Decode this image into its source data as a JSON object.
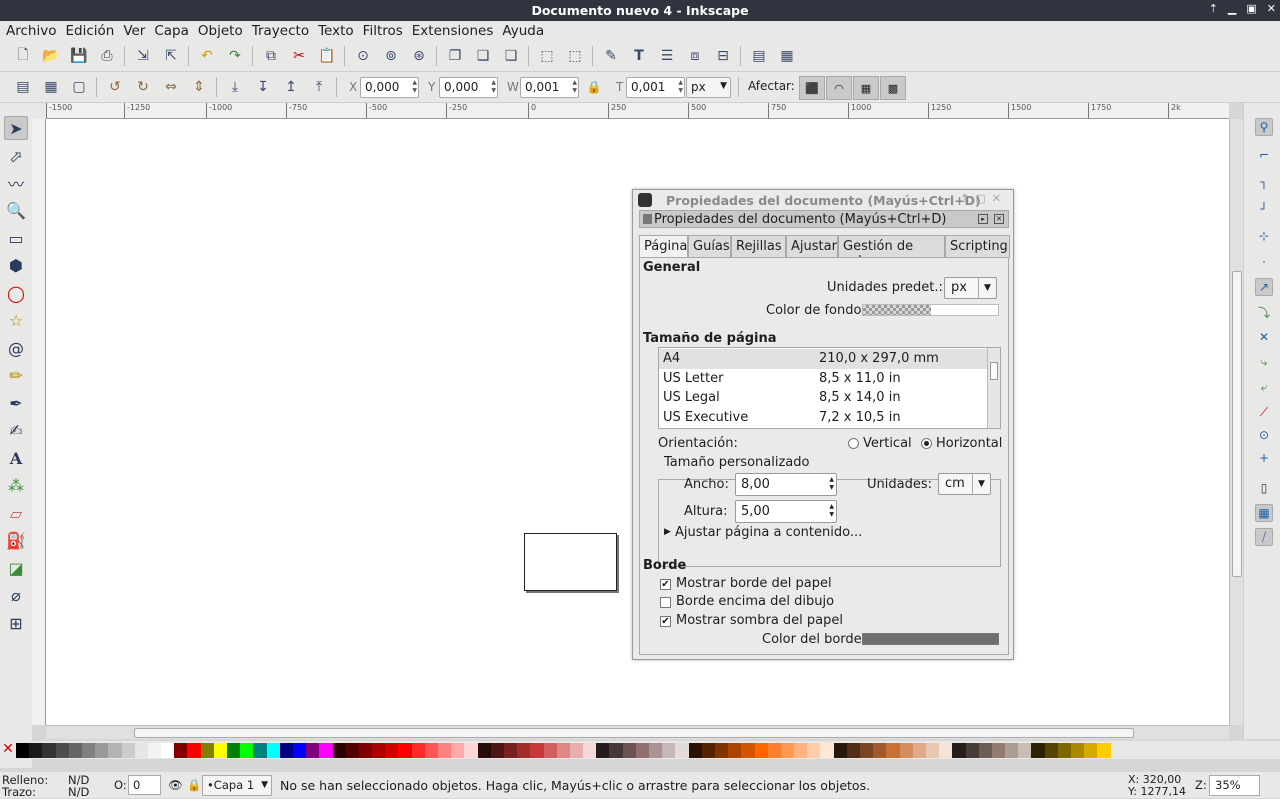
{
  "window": {
    "title": "Documento nuevo 4 - Inkscape"
  },
  "menu": [
    "Archivo",
    "Edición",
    "Ver",
    "Capa",
    "Objeto",
    "Trayecto",
    "Texto",
    "Filtros",
    "Extensiones",
    "Ayuda"
  ],
  "toolbar2": {
    "x_label": "X",
    "x_value": "0,000",
    "y_label": "Y",
    "y_value": "0,000",
    "w_label": "W",
    "w_value": "0,001",
    "h_label": "T",
    "h_value": "0,001",
    "unit": "px",
    "affect_label": "Afectar:"
  },
  "ruler": {
    "ticks": [
      "-1500",
      "-1250",
      "-1000",
      "-750",
      "-500",
      "-250",
      "0",
      "250",
      "500",
      "750",
      "1000",
      "1250",
      "1500",
      "1750",
      "2k"
    ]
  },
  "dialog": {
    "window_title": "Propiedades del documento (Mayús+Ctrl+D)",
    "dock_title": "Propiedades del documento (Mayús+Ctrl+D)",
    "tabs": [
      "Página",
      "Guías",
      "Rejillas",
      "Ajustar",
      "Gestión de color",
      "Scripting"
    ],
    "general": {
      "heading": "General",
      "units_label": "Unidades predet.:",
      "units_value": "px",
      "bg_color_label": "Color de fondo:"
    },
    "page_size": {
      "heading": "Tamaño de página",
      "rows": [
        {
          "name": "A4",
          "size": "210,0 x 297,0 mm"
        },
        {
          "name": "US Letter",
          "size": "8,5 x 11,0 in"
        },
        {
          "name": "US Legal",
          "size": "8,5 x 14,0 in"
        },
        {
          "name": "US Executive",
          "size": "7,2 x 10,5 in"
        }
      ],
      "orientation_label": "Orientación:",
      "vertical": "Vertical",
      "horizontal": "Horizontal",
      "orientation_selected": "Horizontal"
    },
    "custom_size": {
      "legend": "Tamaño personalizado",
      "width_label": "Ancho:",
      "width_value": "8,00",
      "height_label": "Altura:",
      "height_value": "5,00",
      "units_label": "Unidades:",
      "units_value": "cm",
      "fit_label": "Ajustar página a contenido..."
    },
    "border": {
      "heading": "Borde",
      "show_border": "Mostrar borde del papel",
      "border_on_top": "Borde encima del dibujo",
      "show_shadow": "Mostrar sombra del papel",
      "border_color_label": "Color del borde:",
      "border_color": "#6f6f6f"
    }
  },
  "status": {
    "fill_label": "Relleno:",
    "fill_value": "N/D",
    "stroke_label": "Trazo:",
    "stroke_value": "N/D",
    "opacity_label": "O:",
    "opacity_value": "0",
    "layer": "•Capa 1",
    "message": "No se han seleccionado objetos. Haga clic, Mayús+clic o arrastre para seleccionar los objetos.",
    "x_coord": "X: 320,00",
    "y_coord": "Y: 1277,14",
    "zoom_label": "Z:",
    "zoom_value": "35%"
  },
  "palette_colors": [
    "#000000",
    "#1a1a1a",
    "#333333",
    "#4d4d4d",
    "#666666",
    "#808080",
    "#999999",
    "#b3b3b3",
    "#cccccc",
    "#e6e6e6",
    "#f2f2f2",
    "#ffffff",
    "#800000",
    "#ff0000",
    "#808000",
    "#ffff00",
    "#008000",
    "#00ff00",
    "#008080",
    "#00ffff",
    "#000080",
    "#0000ff",
    "#800080",
    "#ff00ff",
    "#2b0000",
    "#550000",
    "#800000",
    "#aa0000",
    "#d40000",
    "#ff0000",
    "#ff2a2a",
    "#ff5555",
    "#ff8080",
    "#ffaaaa",
    "#ffd5d5",
    "#280b0b",
    "#501616",
    "#782121",
    "#a02c2c",
    "#c83737",
    "#d35f5f",
    "#de8787",
    "#e9afaf",
    "#f4d7d7",
    "#241c1c",
    "#483737",
    "#6c5353",
    "#916f6f",
    "#ac9393",
    "#c8b7b7",
    "#e3dbdb",
    "#2b1100",
    "#552200",
    "#803300",
    "#aa4400",
    "#d45500",
    "#ff6600",
    "#ff7f2a",
    "#ff9955",
    "#ffb380",
    "#ffccaa",
    "#ffe6d5",
    "#28170b",
    "#502d16",
    "#784421",
    "#a05a2c",
    "#c87137",
    "#d38d5f",
    "#deaa87",
    "#e9c6af",
    "#f4e3d7",
    "#241f1c",
    "#483e37",
    "#6c5d53",
    "#917c6f",
    "#ac9d93",
    "#c8beb7",
    "#2b2200",
    "#554400",
    "#806600",
    "#aa8800",
    "#d4aa00",
    "#ffcc00"
  ]
}
